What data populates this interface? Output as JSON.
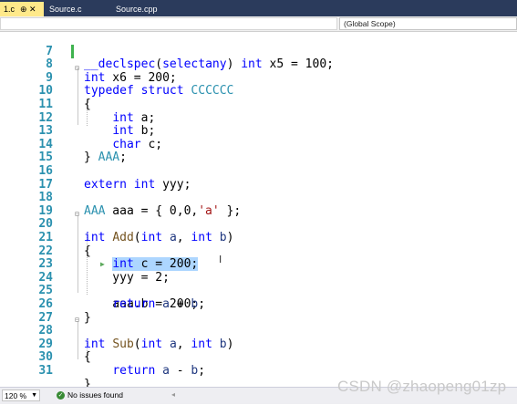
{
  "tabs": [
    {
      "label": "1.c",
      "pin": "⊕ ✕"
    },
    {
      "label": "Source.c"
    },
    {
      "label": "Source.cpp"
    }
  ],
  "scope": "(Global Scope)",
  "code_lines": [
    {
      "n": "7"
    },
    {
      "n": "8"
    },
    {
      "n": "9"
    },
    {
      "n": "10"
    },
    {
      "n": "11"
    },
    {
      "n": "12"
    },
    {
      "n": "13"
    },
    {
      "n": "14"
    },
    {
      "n": "15"
    },
    {
      "n": "16"
    },
    {
      "n": "17"
    },
    {
      "n": "18"
    },
    {
      "n": "19"
    },
    {
      "n": "20"
    },
    {
      "n": "21"
    },
    {
      "n": "22"
    },
    {
      "n": "23"
    },
    {
      "n": "24"
    },
    {
      "n": "25"
    },
    {
      "n": "26"
    },
    {
      "n": "27"
    },
    {
      "n": "28"
    },
    {
      "n": "29"
    },
    {
      "n": "30"
    },
    {
      "n": "31"
    }
  ],
  "status": {
    "zoom": "120 %",
    "issues": "No issues found"
  },
  "watermark": "CSDN @zhaopeng01zp",
  "colors": {
    "keyword": "#0000ff",
    "string": "#a31515",
    "type": "#2b91af",
    "selection": "#add6ff",
    "tab_active": "#ffe98a"
  }
}
